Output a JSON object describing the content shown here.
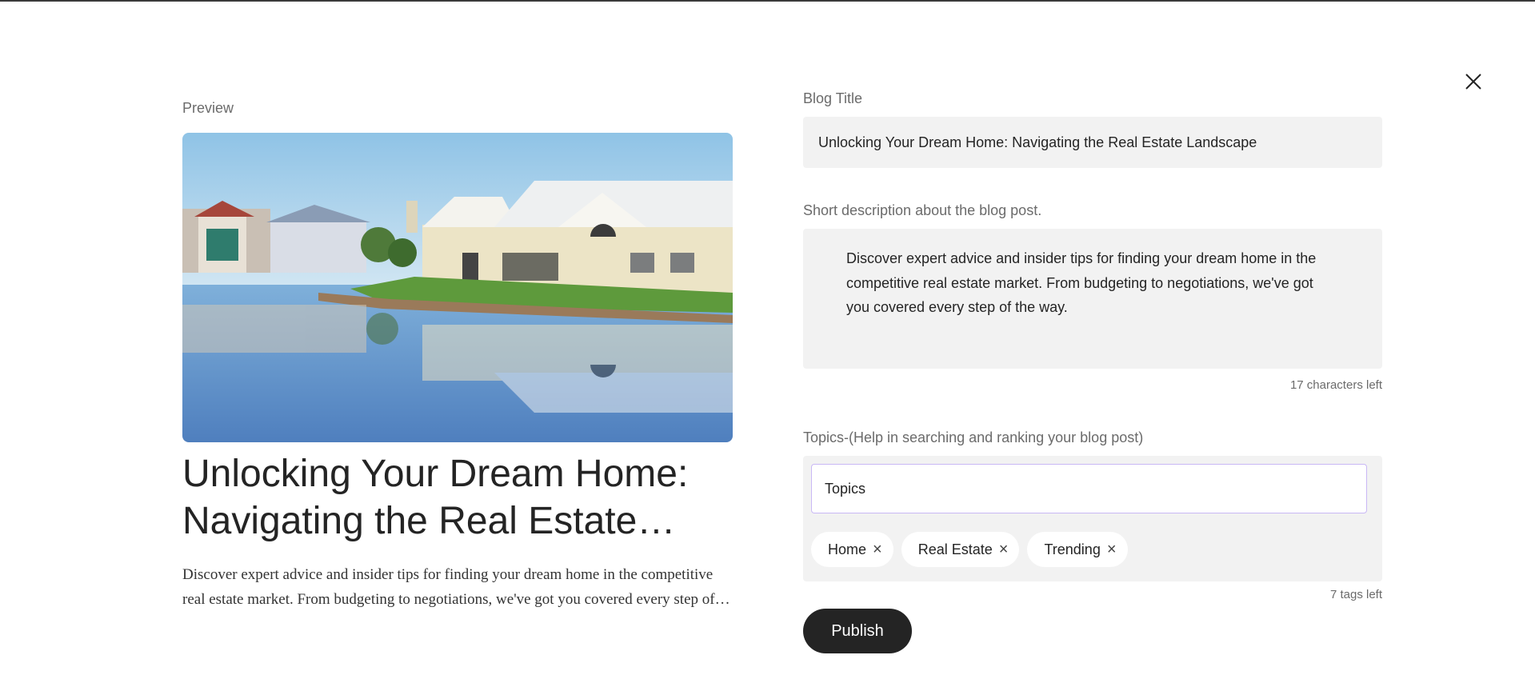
{
  "preview": {
    "label": "Preview",
    "title": "Unlocking Your Dream Home: Navigating the Real Estate Landscape",
    "description": "Discover expert advice and insider tips for finding your dream home in the competitive real estate market. From budgeting to negotiations, we've got you covered every step of the way."
  },
  "form": {
    "title_label": "Blog Title",
    "title_value": "Unlocking Your Dream Home: Navigating the Real Estate Landscape",
    "description_label": "Short description about the blog post.",
    "description_value": "Discover expert advice and insider tips for finding your dream home in the competitive real estate market. From budgeting to negotiations, we've got you covered every step of the way.",
    "chars_left": "17 characters left",
    "topics_label": "Topics-(Help in searching and ranking your blog post)",
    "topics_placeholder": "Topics",
    "tags": [
      {
        "label": "Home"
      },
      {
        "label": "Real Estate"
      },
      {
        "label": "Trending"
      }
    ],
    "tags_left": "7 tags left",
    "publish_label": "Publish"
  },
  "icons": {
    "close": "close-icon",
    "tag_remove": "close-icon"
  },
  "colors": {
    "primary_button": "#242424",
    "field_background": "#f2f2f2",
    "focus_border": "#c9b8f5"
  }
}
